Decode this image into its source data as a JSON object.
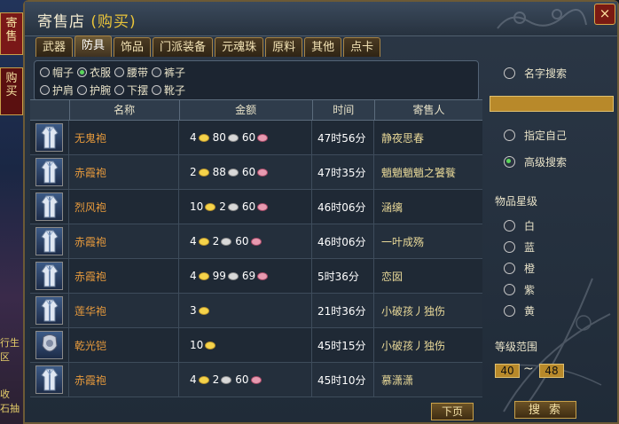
{
  "side": {
    "tab1": "寄售",
    "tab2": "购买",
    "scrap1": "行生",
    "scrap2": "区",
    "scrap3": "收",
    "scrap4": "石抽"
  },
  "window": {
    "title": "寄售店",
    "subtitle": "(购买)",
    "close": "×"
  },
  "tabs": [
    {
      "label": "武器"
    },
    {
      "label": "防具"
    },
    {
      "label": "饰品"
    },
    {
      "label": "门派装备"
    },
    {
      "label": "元魂珠"
    },
    {
      "label": "原料"
    },
    {
      "label": "其他"
    },
    {
      "label": "点卡"
    }
  ],
  "active_tab": "防具",
  "filters": {
    "row1": [
      "帽子",
      "衣服",
      "腰带",
      "裤子"
    ],
    "row2": [
      "护肩",
      "护腕",
      "下摆",
      "靴子"
    ],
    "selected": "衣服"
  },
  "table": {
    "headers": [
      "名称",
      "金额",
      "时间",
      "寄售人"
    ],
    "rows": [
      {
        "name": "无鬼袍",
        "gold": "4",
        "silver": "80",
        "copper": "60",
        "time": "47时56分",
        "seller": "静夜思春"
      },
      {
        "name": "赤霞袍",
        "gold": "2",
        "silver": "88",
        "copper": "60",
        "time": "47时35分",
        "seller": "魈魈魈魈之饕餮"
      },
      {
        "name": "烈风袍",
        "gold": "10",
        "silver": "2",
        "copper": "60",
        "time": "46时06分",
        "seller": "涵缡"
      },
      {
        "name": "赤霞袍",
        "gold": "4",
        "silver": "2",
        "copper": "60",
        "time": "46时06分",
        "seller": "一叶成殇"
      },
      {
        "name": "赤霞袍",
        "gold": "4",
        "silver": "99",
        "copper": "69",
        "time": "5时36分",
        "seller": "恋囡"
      },
      {
        "name": "莲华袍",
        "gold": "3",
        "silver": "",
        "copper": "",
        "time": "21时36分",
        "seller": "小破孩丿独伤"
      },
      {
        "name": "乾光铠",
        "gold": "10",
        "silver": "",
        "copper": "",
        "time": "45时15分",
        "seller": "小破孩丿独伤"
      },
      {
        "name": "赤霞袍",
        "gold": "4",
        "silver": "2",
        "copper": "60",
        "time": "45时10分",
        "seller": "慕潇潇"
      }
    ]
  },
  "next_page": "下页",
  "right_panel": {
    "name_search": "名字搜索",
    "name_value": "",
    "self_search": "指定自己",
    "advanced_search": "高级搜索",
    "selected_mode": "高级搜索",
    "star_title": "物品星级",
    "stars": [
      "白",
      "蓝",
      "橙",
      "紫",
      "黄"
    ],
    "level_title": "等级范围",
    "level_min": "40",
    "tilde": "~",
    "level_max": "48",
    "search": "搜索"
  },
  "colors": {
    "item_name": "#e79a3c",
    "gold_coin": "#f5d34a",
    "silver_coin": "#d8d8d8",
    "copper_coin": "#e79ab0",
    "input": "#b8892a"
  }
}
